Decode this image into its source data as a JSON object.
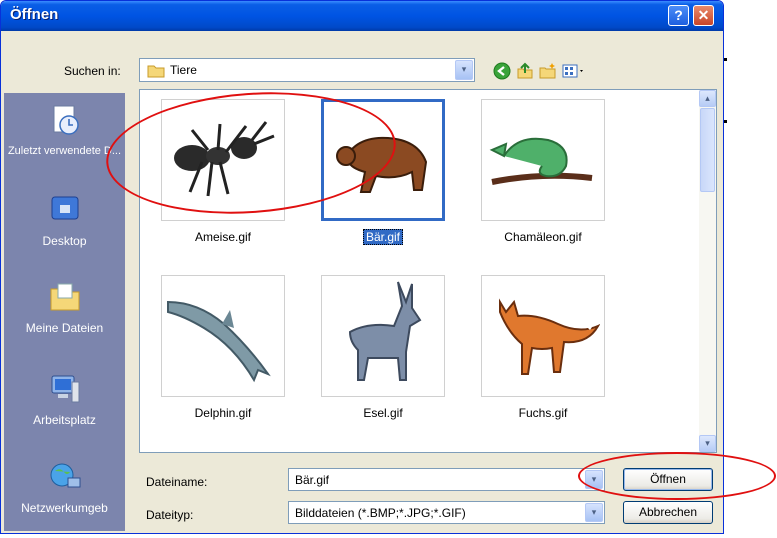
{
  "window": {
    "title": "Öffnen",
    "help_glyph": "?",
    "close_glyph": "✕"
  },
  "lookin": {
    "label": "Suchen in:",
    "value": "Tiere",
    "dropdown_glyph": "▾"
  },
  "toolbar": {
    "icons": [
      "back-icon",
      "up-folder-icon",
      "new-folder-icon",
      "view-menu-icon"
    ]
  },
  "places": [
    {
      "label": "Zuletzt verwendete D...",
      "icon": "recent-documents-icon"
    },
    {
      "label": "Desktop",
      "icon": "desktop-icon"
    },
    {
      "label": "Meine Dateien",
      "icon": "my-documents-icon"
    },
    {
      "label": "Arbeitsplatz",
      "icon": "my-computer-icon"
    },
    {
      "label": "Netzwerkumgeb",
      "icon": "network-places-icon"
    }
  ],
  "files": [
    {
      "name": "Ameise.gif",
      "icon": "ant-thumbnail",
      "selected": false
    },
    {
      "name": "Bär.gif",
      "icon": "bear-thumbnail",
      "selected": true
    },
    {
      "name": "Chamäleon.gif",
      "icon": "chameleon-thumbnail",
      "selected": false
    },
    {
      "name": "Delphin.gif",
      "icon": "dolphin-thumbnail",
      "selected": false
    },
    {
      "name": "Esel.gif",
      "icon": "donkey-thumbnail",
      "selected": false
    },
    {
      "name": "Fuchs.gif",
      "icon": "fox-thumbnail",
      "selected": false
    }
  ],
  "scrollbar": {
    "up_glyph": "▴",
    "down_glyph": "▾"
  },
  "filename": {
    "label": "Dateiname:",
    "value": "Bär.gif",
    "dropdown_glyph": "▾"
  },
  "filetype": {
    "label": "Dateityp:",
    "value": "Bilddateien (*.BMP;*.JPG;*.GIF)",
    "dropdown_glyph": "▾"
  },
  "buttons": {
    "open": "Öffnen",
    "cancel": "Abbrechen"
  },
  "colors": {
    "titlebar": "#0054e3",
    "dialog_bg": "#ece9d8",
    "places_bar": "#7c85ad",
    "selection": "#316ac5",
    "annotation": "#e01010"
  }
}
